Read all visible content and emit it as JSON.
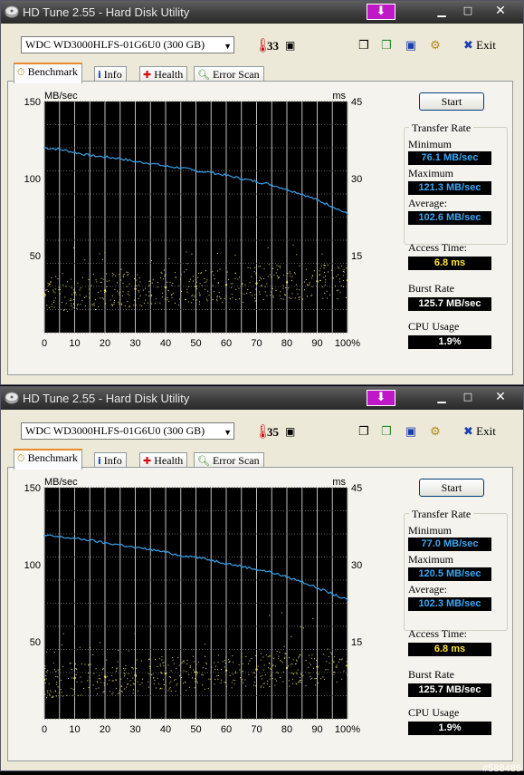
{
  "windows": [
    {
      "title": "HD Tune 2.55 - Hard Disk Utility",
      "drive": "WDC WD3000HLFS-01G6U0 (300 GB)",
      "temperature": "33",
      "exit_label": "Exit",
      "tabs": [
        "Benchmark",
        "Info",
        "Health",
        "Error Scan"
      ],
      "start_label": "Start",
      "transfer_rate_title": "Transfer Rate",
      "minimum_label": "Minimum",
      "minimum": "76.1 MB/sec",
      "maximum_label": "Maximum",
      "maximum": "121.3 MB/sec",
      "average_label": "Average:",
      "average": "102.6 MB/sec",
      "access_label": "Access Time:",
      "access": "6.8 ms",
      "burst_label": "Burst Rate",
      "burst": "125.7 MB/sec",
      "cpu_label": "CPU Usage",
      "cpu": "1.9%"
    },
    {
      "title": "HD Tune 2.55 - Hard Disk Utility",
      "drive": "WDC WD3000HLFS-01G6U0 (300 GB)",
      "temperature": "35",
      "exit_label": "Exit",
      "tabs": [
        "Benchmark",
        "Info",
        "Health",
        "Error Scan"
      ],
      "start_label": "Start",
      "transfer_rate_title": "Transfer Rate",
      "minimum_label": "Minimum",
      "minimum": "77.0 MB/sec",
      "maximum_label": "Maximum",
      "maximum": "120.5 MB/sec",
      "average_label": "Average:",
      "average": "102.3 MB/sec",
      "access_label": "Access Time:",
      "access": "6.8 ms",
      "burst_label": "Burst Rate",
      "burst": "125.7 MB/sec",
      "cpu_label": "CPU Usage",
      "cpu": "1.9%"
    }
  ],
  "watermark": "#588485",
  "icons": {
    "app": "hdtune-disk-icon",
    "pin": "pin-down-arrow-icon",
    "thermometer": "thermometer-icon",
    "copy": "copy-icon",
    "copy_info": "copy-info-icon",
    "save": "save-icon",
    "options": "options-icon",
    "exit": "exit-x-icon",
    "benchmark_tab": "stopwatch-icon",
    "info_tab": "info-icon",
    "health_tab": "health-cross-icon",
    "error_scan_tab": "magnifier-icon"
  },
  "colors": {
    "chart_bg": "#000000",
    "grid": "#bfbfbf",
    "transfer_line": "#3aa0e8",
    "access_dots": "#e8e070",
    "value_blue": "#3aa7f5",
    "value_yellow": "#ffe23c",
    "value_white": "#ffffff"
  },
  "chart_data": [
    {
      "type": "line",
      "y_left_label": "MB/sec",
      "y_right_label": "ms",
      "x_ticks": [
        "0",
        "10",
        "20",
        "30",
        "40",
        "50",
        "60",
        "70",
        "80",
        "90",
        "100%"
      ],
      "y_left_ticks": [
        "150",
        "100",
        "50"
      ],
      "y_right_ticks": [
        "45",
        "30",
        "15"
      ],
      "ylim_left": [
        0,
        150
      ],
      "ylim_right": [
        0,
        45
      ],
      "xlim": [
        0,
        100
      ],
      "grid": true,
      "series": [
        {
          "axis": "left",
          "x": [
            0,
            5,
            10,
            15,
            20,
            25,
            30,
            35,
            40,
            45,
            50,
            55,
            60,
            65,
            70,
            75,
            80,
            85,
            90,
            95,
            100
          ],
          "values": [
            120,
            119,
            117,
            115,
            114,
            113,
            111,
            110,
            108,
            107,
            105,
            104,
            102,
            100,
            98,
            96,
            93,
            90,
            86,
            82,
            77
          ]
        },
        {
          "axis": "right",
          "style": "scatter",
          "x": [
            0,
            10,
            20,
            30,
            40,
            50,
            60,
            70,
            80,
            90,
            100
          ],
          "values": [
            7.5,
            7.8,
            8.2,
            8.5,
            8.8,
            9.0,
            9.3,
            9.6,
            9.8,
            10.0,
            10.2
          ]
        }
      ]
    },
    {
      "type": "line",
      "y_left_label": "MB/sec",
      "y_right_label": "ms",
      "x_ticks": [
        "0",
        "10",
        "20",
        "30",
        "40",
        "50",
        "60",
        "70",
        "80",
        "90",
        "100%"
      ],
      "y_left_ticks": [
        "150",
        "100",
        "50"
      ],
      "y_right_ticks": [
        "45",
        "30",
        "15"
      ],
      "ylim_left": [
        0,
        150
      ],
      "ylim_right": [
        0,
        45
      ],
      "xlim": [
        0,
        100
      ],
      "grid": true,
      "series": [
        {
          "axis": "left",
          "x": [
            0,
            5,
            10,
            15,
            20,
            25,
            30,
            35,
            40,
            45,
            50,
            55,
            60,
            65,
            70,
            75,
            80,
            85,
            90,
            95,
            100
          ],
          "values": [
            119,
            118,
            117,
            116,
            114,
            113,
            111,
            110,
            108,
            106,
            105,
            103,
            101,
            99,
            97,
            95,
            92,
            89,
            85,
            81,
            77
          ]
        },
        {
          "axis": "right",
          "style": "scatter",
          "x": [
            0,
            10,
            20,
            30,
            40,
            50,
            60,
            70,
            80,
            90,
            100
          ],
          "values": [
            7.6,
            7.9,
            8.2,
            8.5,
            8.8,
            9.1,
            9.4,
            9.6,
            9.9,
            10.1,
            10.3
          ]
        }
      ]
    }
  ]
}
